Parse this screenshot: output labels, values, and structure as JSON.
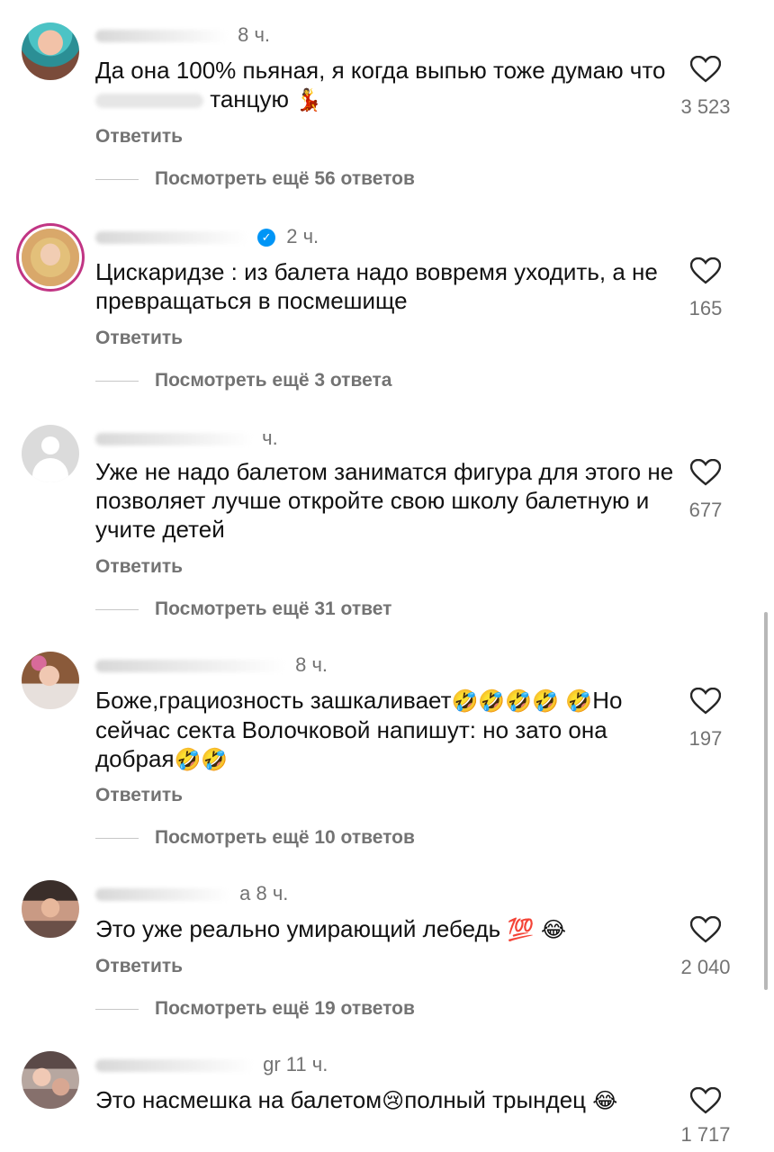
{
  "colors": {
    "meta": "#737373",
    "text": "#111111",
    "verified": "#0095f6",
    "ring": "#c13584"
  },
  "ui": {
    "reply_label": "Ответить",
    "like_icon": "heart-outline-icon"
  },
  "comments": [
    {
      "time": "8 ч.",
      "text_before": "Да она 100% пьяная, я когда выпью тоже думаю что",
      "text_after": "танцую",
      "emoji": "💃",
      "likes": "3 523",
      "more_replies": "Посмотреть ещё 56 ответов"
    },
    {
      "time": "2 ч.",
      "text": "Цискаридзе : из балета надо вовремя уходить, а не превращаться в посмешище",
      "likes": "165",
      "more_replies": "Посмотреть ещё 3 ответа"
    },
    {
      "time": "ч.",
      "text": "Уже не надо балетом заниматся фигура для этого не позволяет лучше откройте свою школу балетную и учите детей",
      "likes": "677",
      "more_replies": "Посмотреть ещё 31 ответ"
    },
    {
      "time": "8 ч.",
      "text_a": "Боже,грациозность зашкаливает",
      "emoji_a": "🤣🤣🤣🤣",
      "emoji_b": "🤣",
      "text_b": "Но сейчас секта Волочковой напишут: но зато она добрая",
      "emoji_c": "🤣🤣",
      "likes": "197",
      "more_replies": "Посмотреть ещё 10 ответов"
    },
    {
      "time": "а 8 ч.",
      "text": "Это уже реально умирающий лебедь",
      "emoji": "💯 😂",
      "likes": "2 040",
      "more_replies": "Посмотреть ещё 19 ответов"
    },
    {
      "time": "gr 11 ч.",
      "text_a": "Это  насмешка на балетом",
      "emoji_a": "😢",
      "text_b": "полный трындец",
      "emoji_b": "😂",
      "likes": "1 717"
    }
  ]
}
